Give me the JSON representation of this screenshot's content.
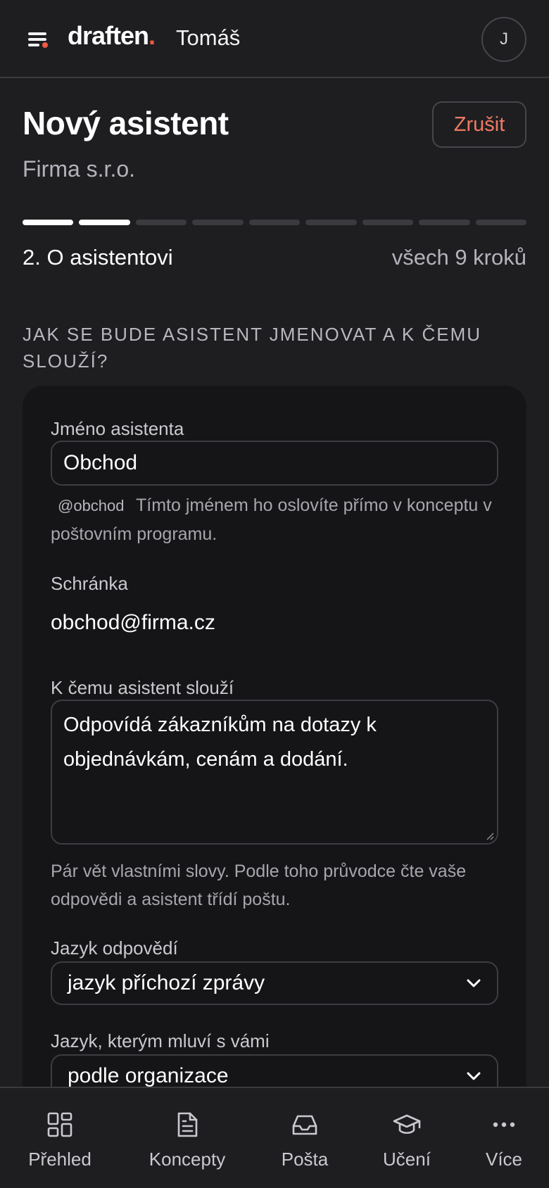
{
  "header": {
    "logo_text": "draften",
    "logo_dot": ".",
    "user_name": "Tomáš",
    "avatar_initial": "J"
  },
  "page": {
    "title": "Nový asistent",
    "subtitle": "Firma s.r.o.",
    "cancel_label": "Zrušit"
  },
  "progress": {
    "current_step": 2,
    "total_steps": 9,
    "step_label": "2. O asistentovi",
    "total_label": "všech 9 kroků"
  },
  "section": {
    "heading": "JAK SE BUDE ASISTENT JMENOVAT A K ČEMU SLOUŽÍ?"
  },
  "form": {
    "name_label": "Jméno asistenta",
    "name_value": "Obchod",
    "mention": "@obchod",
    "name_hint": "Tímto jménem ho oslovíte přímo v konceptu v poštovním programu.",
    "mailbox_label": "Schránka",
    "mailbox_value": "obchod@firma.cz",
    "purpose_label": "K čemu asistent slouží",
    "purpose_value": "Odpovídá zákazníkům na dotazy k objednávkám, cenám a dodání.",
    "purpose_hint": "Pár vět vlastními slovy. Podle toho průvodce čte vaše odpovědi a asistent třídí poštu.",
    "reply_lang_label": "Jazyk odpovědí",
    "reply_lang_value": "jazyk příchozí zprávy",
    "ui_lang_label": "Jazyk, kterým mluví s vámi",
    "ui_lang_value": "podle organizace"
  },
  "nav": {
    "items": [
      {
        "label": "Přehled",
        "icon": "grid-icon"
      },
      {
        "label": "Koncepty",
        "icon": "document-icon"
      },
      {
        "label": "Pošta",
        "icon": "inbox-icon"
      },
      {
        "label": "Učení",
        "icon": "graduation-cap-icon"
      },
      {
        "label": "Více",
        "icon": "more-icon"
      }
    ]
  },
  "colors": {
    "background": "#1e1e21",
    "card": "#151517",
    "accent": "#ef5a45",
    "cancel_text": "#f07a63"
  }
}
